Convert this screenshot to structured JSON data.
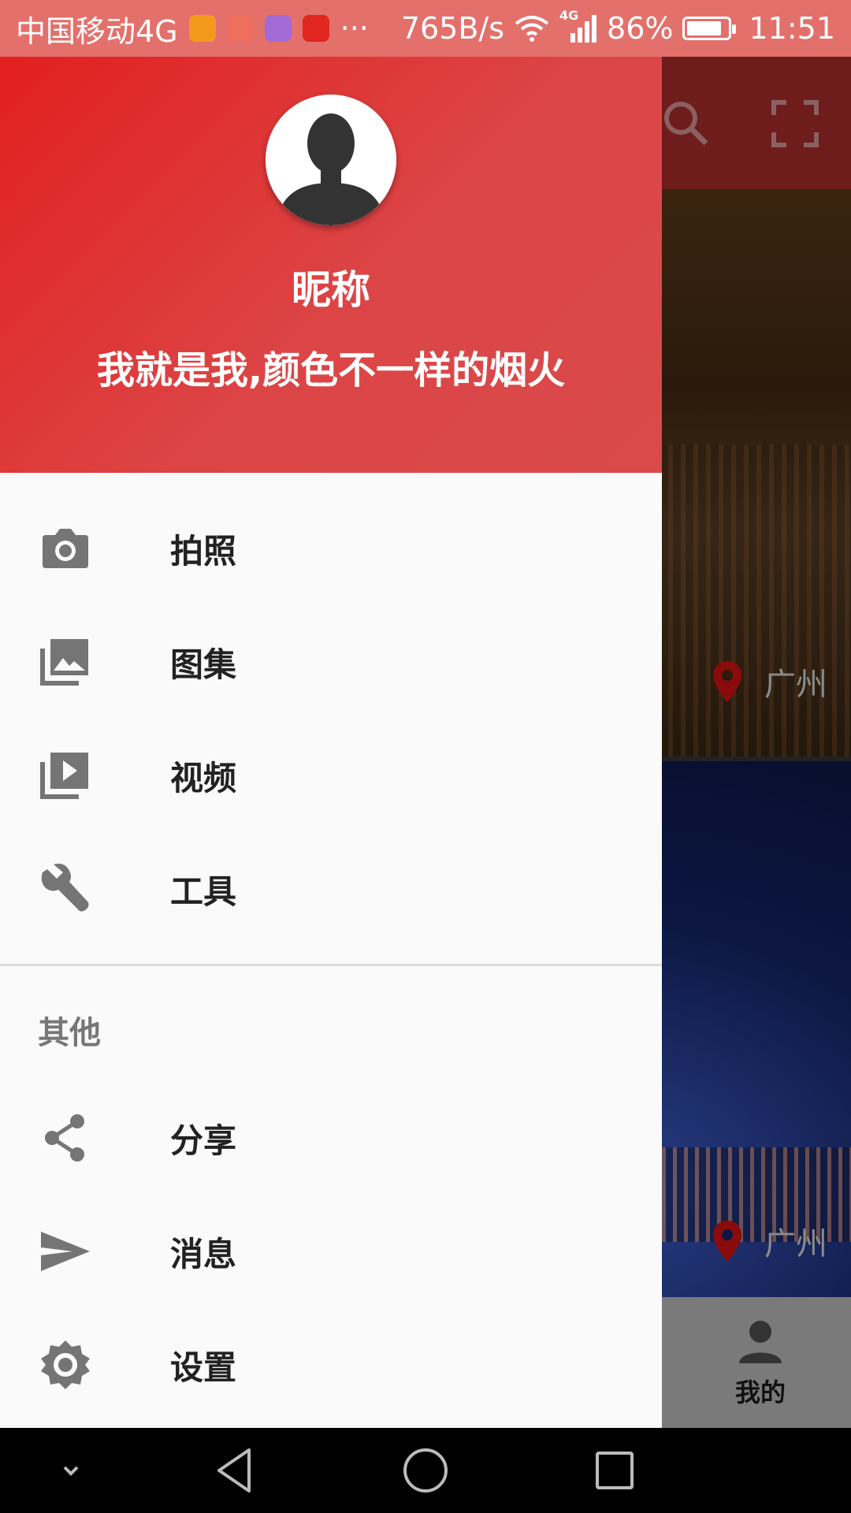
{
  "status_bar": {
    "carrier": "中国移动4G",
    "more": "···",
    "net_speed": "765B/s",
    "network_type": "4G",
    "battery_percent": "86%",
    "battery_level": 0.86,
    "time": "11:51",
    "app_icons": [
      "health-app-icon",
      "mail-app-icon",
      "gallery-app-icon",
      "huawei-app-icon"
    ],
    "bg_color": "#e3706b"
  },
  "main": {
    "toolbar_icons": [
      "search-icon",
      "fullscreen-icon"
    ],
    "cards": [
      {
        "location": "广州"
      },
      {
        "location": "广州"
      }
    ],
    "bottom_nav": {
      "mine_label": "我的"
    }
  },
  "drawer": {
    "header": {
      "nickname": "昵称",
      "signature": "我就是我,颜色不一样的烟火",
      "accent": "#e21f1f"
    },
    "items": [
      {
        "label": "拍照",
        "icon": "camera-icon"
      },
      {
        "label": "图集",
        "icon": "gallery-icon"
      },
      {
        "label": "视频",
        "icon": "video-library-icon"
      },
      {
        "label": "工具",
        "icon": "wrench-icon"
      }
    ],
    "section_title": "其他",
    "other_items": [
      {
        "label": "分享",
        "icon": "share-icon"
      },
      {
        "label": "消息",
        "icon": "send-icon"
      },
      {
        "label": "设置",
        "icon": "settings-icon"
      }
    ]
  },
  "system_nav": [
    "collapse-icon",
    "back-icon",
    "home-icon",
    "recents-icon"
  ]
}
